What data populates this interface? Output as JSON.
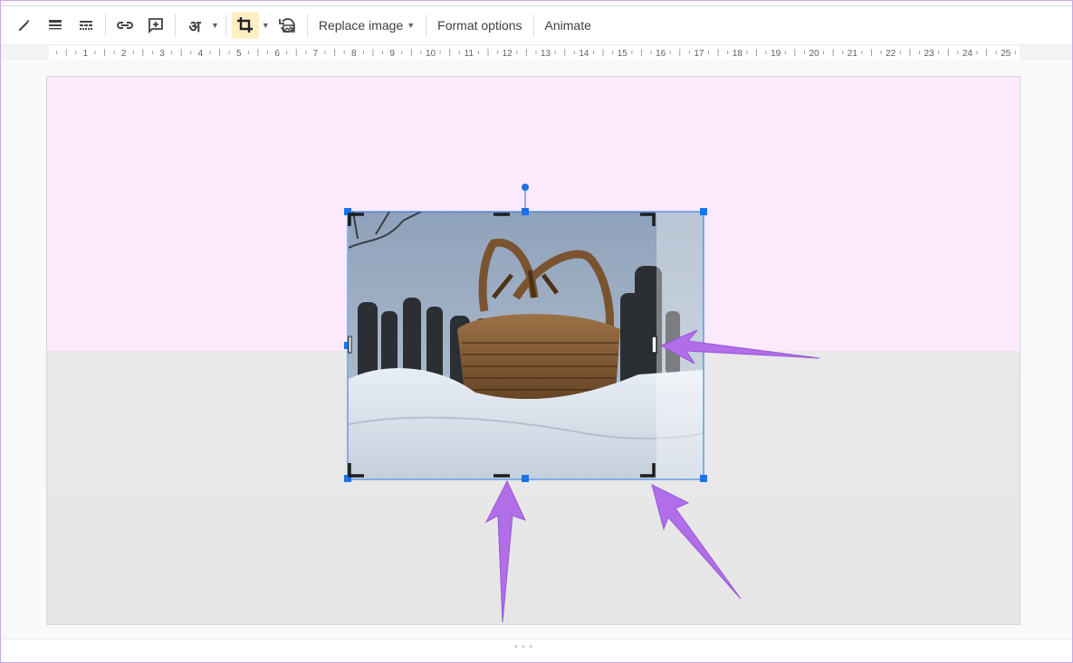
{
  "toolbar": {
    "items": [
      {
        "icon": "pencil-icon"
      },
      {
        "icon": "line-weight-icon"
      },
      {
        "icon": "line-dash-icon"
      },
      {
        "icon": "link-icon"
      },
      {
        "icon": "add-comment-icon"
      },
      {
        "icon": "input-tools-icon",
        "glyph": "अ"
      },
      {
        "icon": "crop-icon",
        "active": true
      },
      {
        "icon": "reset-image-icon"
      }
    ],
    "replace_image_label": "Replace image",
    "format_options_label": "Format options",
    "animate_label": "Animate"
  },
  "ruler": {
    "labels": [
      "1",
      "2",
      "3",
      "4",
      "5",
      "6",
      "7",
      "8",
      "9",
      "10",
      "11",
      "12",
      "13",
      "14",
      "15",
      "16",
      "17",
      "18",
      "19",
      "20",
      "21",
      "22",
      "23",
      "24",
      "25"
    ]
  },
  "colors": {
    "accent": "#1a73e8",
    "slide_top": "#fde9fc",
    "slide_bottom": "#e9e9e9",
    "arrow": "#b06ee8",
    "crop_active_bg": "#feefc3"
  }
}
